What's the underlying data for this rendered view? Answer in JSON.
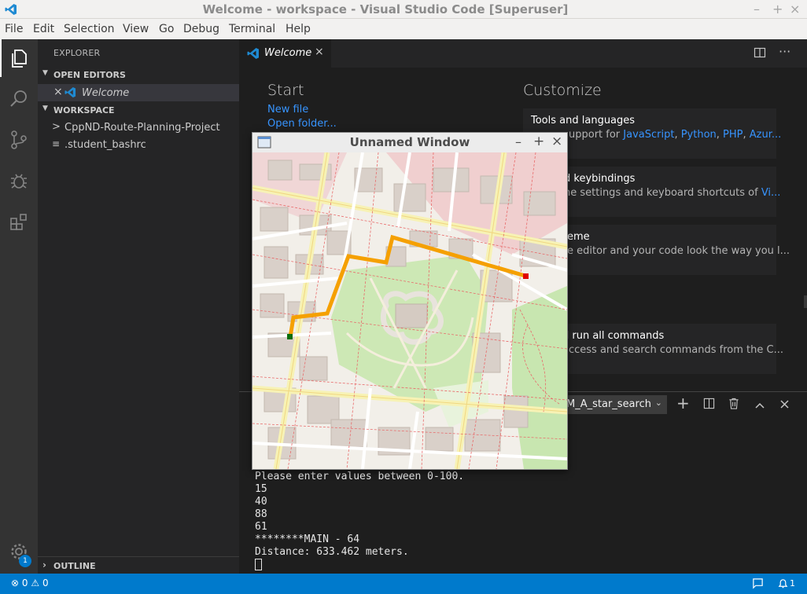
{
  "window": {
    "title": "Welcome - workspace - Visual Studio Code [Superuser]",
    "controls": [
      "–",
      "+",
      "×"
    ]
  },
  "menu": [
    "File",
    "Edit",
    "Selection",
    "View",
    "Go",
    "Debug",
    "Terminal",
    "Help"
  ],
  "activity_bar": {
    "icons": [
      "files-icon",
      "search-icon",
      "source-control-icon",
      "debug-icon",
      "extensions-icon"
    ],
    "settings_badge": "1"
  },
  "sidebar": {
    "header": "EXPLORER",
    "open_editors": {
      "label": "OPEN EDITORS",
      "items": [
        {
          "close": "×",
          "name": "Welcome"
        }
      ]
    },
    "workspace": {
      "label": "WORKSPACE",
      "items": [
        {
          "chevron": ">",
          "name": "CppND-Route-Planning-Project"
        },
        {
          "chevron": "≡",
          "name": ".student_bashrc"
        }
      ]
    },
    "outline": {
      "label": "OUTLINE"
    }
  },
  "editor": {
    "tab": {
      "label": "Welcome",
      "close": "×"
    },
    "welcome": {
      "start_heading": "Start",
      "start_links": [
        "New file",
        "Open folder..."
      ],
      "customize_heading": "Customize",
      "cards": [
        {
          "title": "Tools and languages",
          "desc_prefix": "upport for ",
          "desc_links": [
            "JavaScript",
            "Python",
            "PHP",
            "Azur..."
          ]
        },
        {
          "title": "d keybindings",
          "desc_prefix": "he settings and keyboard shortcuts of ",
          "desc_links": [
            "Vi..."
          ]
        },
        {
          "title": "eme",
          "desc_prefix": "e editor and your code look the way you l...",
          "desc_links": []
        },
        {
          "title": "d run all commands",
          "desc_prefix": "access and search commands from the C...",
          "desc_links": []
        }
      ]
    }
  },
  "panel": {
    "terminal_selector": "M_A_star_search",
    "terminal_lines": [
      "Please enter values between 0-100.",
      "15",
      "40",
      "88",
      "61",
      "********MAIN - 64",
      "Distance: 633.462 meters."
    ]
  },
  "popup": {
    "title": "Unnamed Window",
    "controls": [
      "–",
      "+",
      "×"
    ],
    "route": {
      "start_color": "#0a6e0a",
      "end_color": "#e00000",
      "path_color": "#f5a000"
    }
  },
  "statusbar": {
    "errors": "0",
    "warnings": "0"
  },
  "colors": {
    "accent": "#007acc",
    "link": "#3794ff"
  }
}
